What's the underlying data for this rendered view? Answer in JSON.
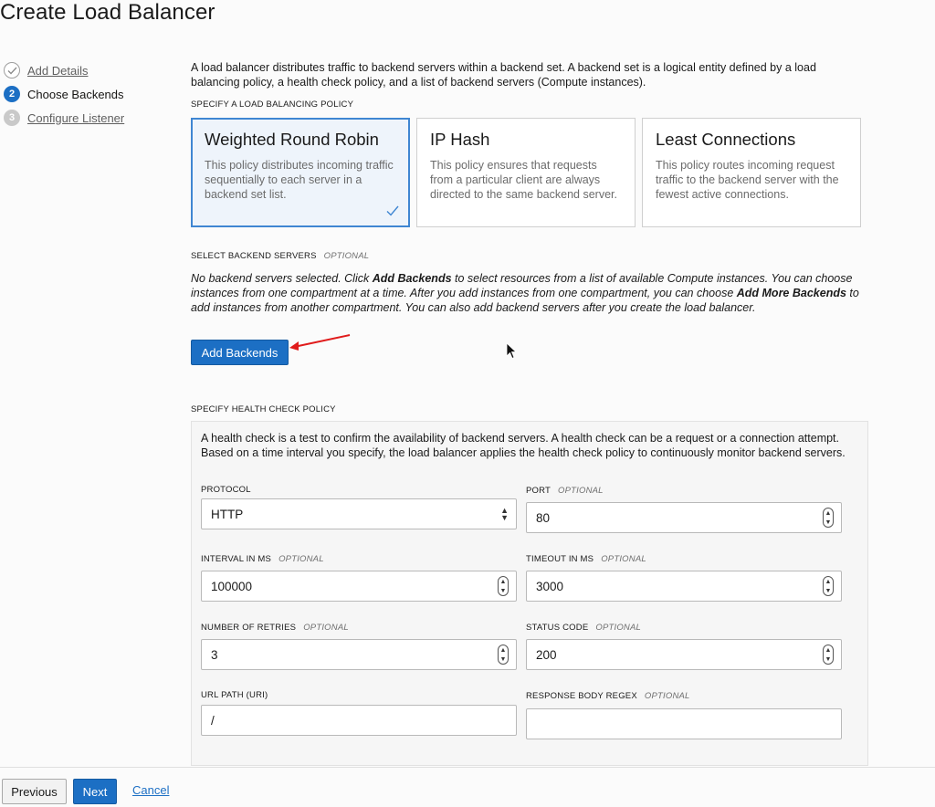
{
  "page": {
    "title": "Create Load Balancer"
  },
  "steps": [
    {
      "number": "1",
      "label": "Add Details",
      "state": "done"
    },
    {
      "number": "2",
      "label": "Choose Backends",
      "state": "current"
    },
    {
      "number": "3",
      "label": "Configure Listener",
      "state": "future"
    }
  ],
  "intro": "A load balancer distributes traffic to backend servers within a backend set. A backend set is a logical entity defined by a load balancing policy, a health check policy, and a list of backend servers (Compute instances).",
  "policy": {
    "section_label": "SPECIFY A LOAD BALANCING POLICY",
    "cards": [
      {
        "title": "Weighted Round Robin",
        "description": "This policy distributes incoming traffic sequentially to each server in a backend set list.",
        "selected": true
      },
      {
        "title": "IP Hash",
        "description": "This policy ensures that requests from a particular client are always directed to the same backend server.",
        "selected": false
      },
      {
        "title": "Least Connections",
        "description": "This policy routes incoming request traffic to the backend server with the fewest active connections.",
        "selected": false
      }
    ]
  },
  "backends": {
    "section_label": "SELECT BACKEND SERVERS",
    "optional": "OPTIONAL",
    "note_part1": "No backend servers selected. Click ",
    "note_bold1": "Add Backends",
    "note_part2": " to select resources from a list of available Compute instances. You can choose instances from one compartment at a time. After you add instances from one compartment, you can choose ",
    "note_bold2": "Add More Backends",
    "note_part3": " to add instances from another compartment. You can also add backend servers after you create the load balancer.",
    "add_button": "Add Backends"
  },
  "health": {
    "section_label": "SPECIFY HEALTH CHECK POLICY",
    "description": "A health check is a test to confirm the availability of backend servers. A health check can be a request or a connection attempt. Based on a time interval you specify, the load balancer applies the health check policy to continuously monitor backend servers.",
    "optional": "OPTIONAL",
    "protocol": {
      "label": "PROTOCOL",
      "value": "HTTP"
    },
    "port": {
      "label": "PORT",
      "value": "80"
    },
    "interval": {
      "label": "INTERVAL IN MS",
      "value": "100000"
    },
    "timeout": {
      "label": "TIMEOUT IN MS",
      "value": "3000"
    },
    "retries": {
      "label": "NUMBER OF RETRIES",
      "value": "3"
    },
    "status_code": {
      "label": "STATUS CODE",
      "value": "200"
    },
    "url_path": {
      "label": "URL PATH (URI)",
      "value": "/"
    },
    "regex": {
      "label": "RESPONSE BODY REGEX",
      "value": ""
    }
  },
  "footer": {
    "previous": "Previous",
    "next": "Next",
    "cancel": "Cancel"
  },
  "colors": {
    "primary": "#1c6fc4",
    "selected_card_bg": "#eef4fb",
    "annotation_arrow": "#e01b1b"
  }
}
